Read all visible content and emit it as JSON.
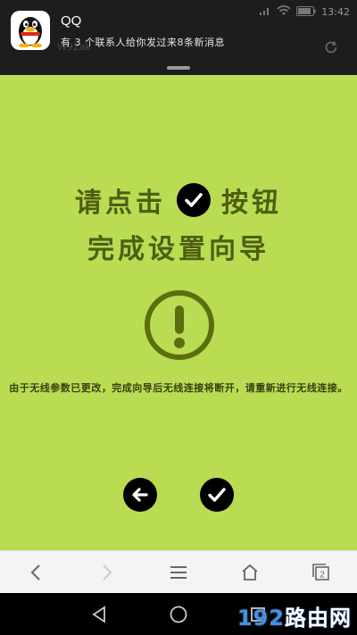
{
  "notification": {
    "app_name": "QQ",
    "message": "有 3 个联系人给你发过来8条新消息",
    "status_time": "13:42",
    "behind_text": "W92ak"
  },
  "heading": {
    "line1_before": "请点击",
    "line1_after": "按钮",
    "line2": "完成设置向导"
  },
  "notice": "由于无线参数已更改，完成向导后无线连接将断开，请重新进行无线连接。",
  "buttons": {
    "back": "arrow-left-icon",
    "confirm": "check-icon"
  },
  "toolbar": {
    "tab_count": "2"
  },
  "watermark": {
    "number": "192",
    "text": "路由网"
  },
  "colors": {
    "background": "#b9dc53",
    "heading": "#4e5e12",
    "icon_olive": "#5d6e0e"
  }
}
